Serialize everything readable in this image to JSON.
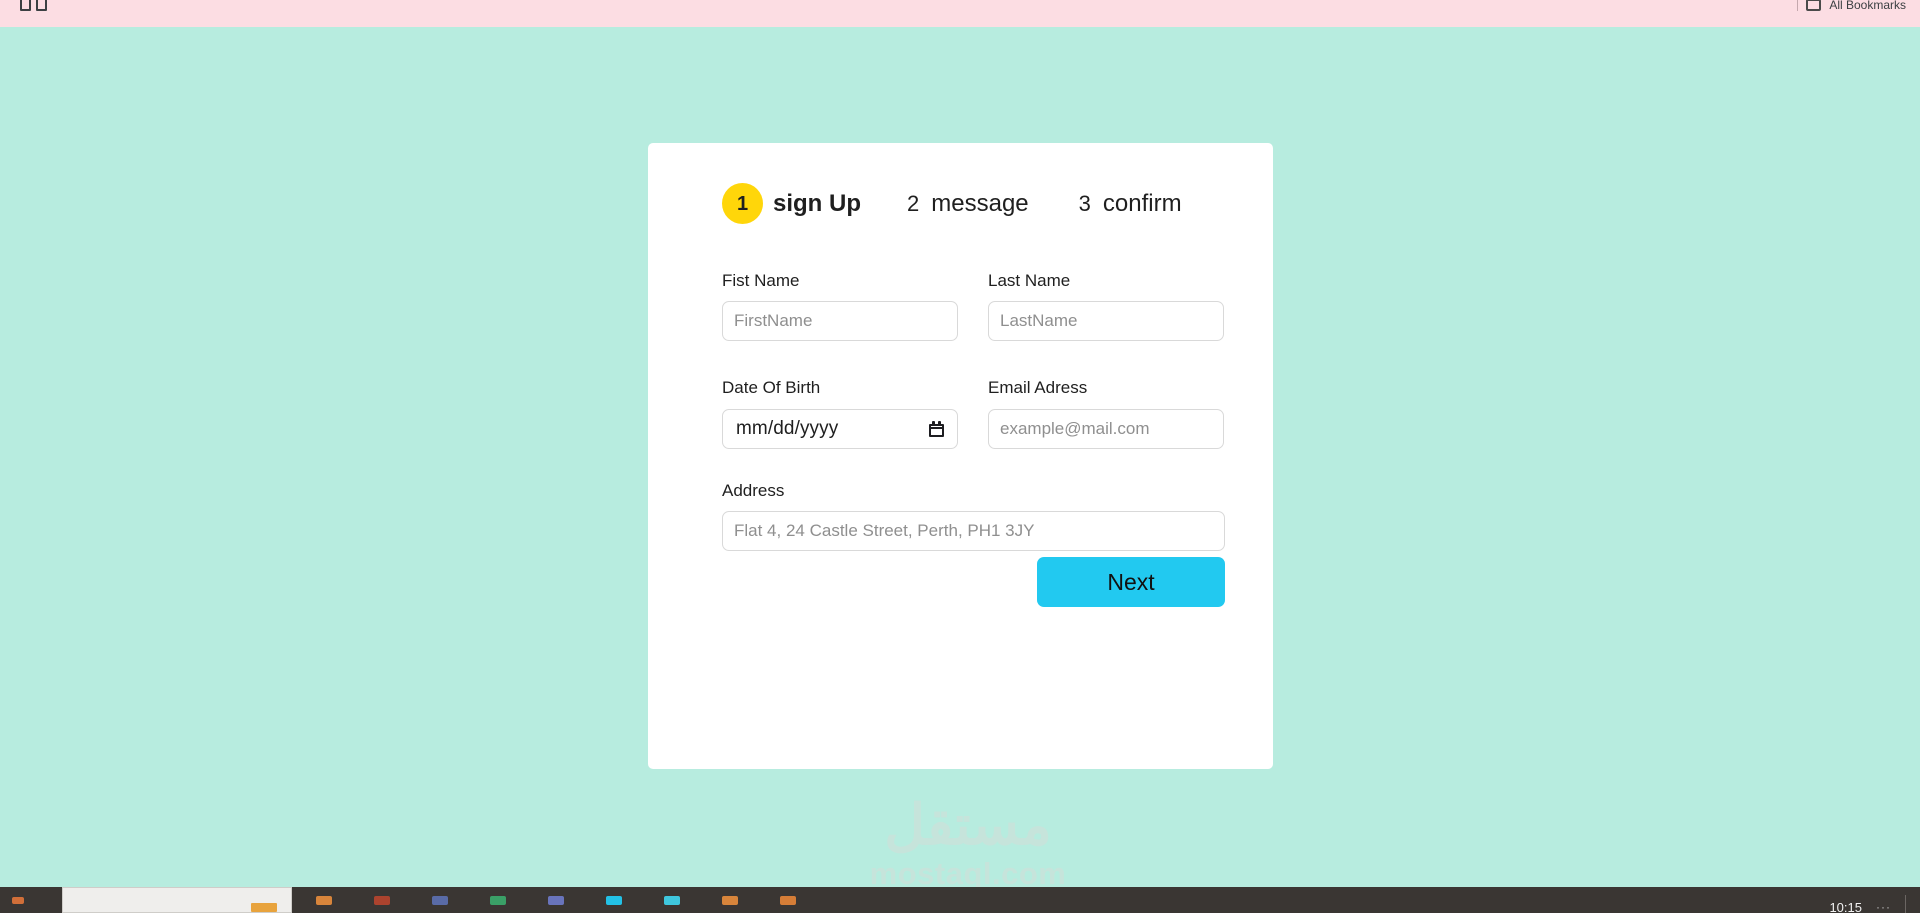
{
  "browser": {
    "bookmark_items": [
      "",
      ""
    ],
    "all_bookmarks_label": "All Bookmarks"
  },
  "theme": {
    "page_background": "#b7ecdf",
    "bookmark_bar_background": "#fcdde3",
    "card_background": "#ffffff",
    "accent_step_active": "#ffd60a",
    "accent_button": "#22c9f0",
    "input_border": "#d9d9d9",
    "placeholder_color": "#8f8f8f",
    "watermark_color": "#c6e4db",
    "taskbar_background": "#3a3633"
  },
  "card": {
    "stepper": [
      {
        "number": "1",
        "label": "sign Up",
        "active": true
      },
      {
        "number": "2",
        "label": "message",
        "active": false
      },
      {
        "number": "3",
        "label": "confirm",
        "active": false
      }
    ],
    "fields": {
      "first_name": {
        "label": "Fist Name",
        "placeholder": "FirstName",
        "value": ""
      },
      "last_name": {
        "label": "Last Name",
        "placeholder": "LastName",
        "value": ""
      },
      "date_of_birth": {
        "label": "Date Of Birth",
        "placeholder": "mm/dd/yyyy",
        "value": "",
        "icon": "calendar-icon"
      },
      "email": {
        "label": "Email Adress",
        "placeholder": "example@mail.com",
        "value": ""
      },
      "address": {
        "label": "Address",
        "placeholder": "Flat 4, 24 Castle Street, Perth, PH1 3JY",
        "value": ""
      }
    },
    "next_button_label": "Next"
  },
  "watermark": {
    "arabic": "مستقل",
    "latin": "mostaql.com"
  },
  "taskbar": {
    "clock": "10:15",
    "tray_dots": "···"
  }
}
